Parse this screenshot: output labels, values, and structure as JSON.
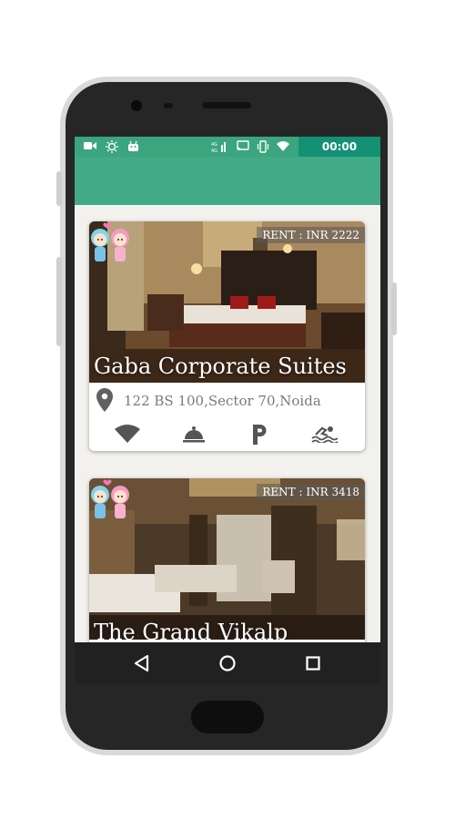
{
  "statusbar": {
    "clock": "00:00",
    "icons": [
      "video-camera-icon",
      "brightness-icon",
      "android-icon",
      "signal-icon",
      "screencast-icon",
      "vibrate-icon",
      "wifi-icon"
    ]
  },
  "listings": [
    {
      "rent": "RENT : INR 2222",
      "name": "Gaba Corporate Suites",
      "address": "122 BS 100,Sector 70,Noida",
      "amenities": [
        "wifi-icon",
        "room-service-icon",
        "parking-icon",
        "pool-icon"
      ]
    },
    {
      "rent": "RENT : INR 3418",
      "name": "The Grand Vikalp"
    }
  ],
  "navbar": {
    "buttons": [
      "back-icon",
      "home-icon",
      "recents-icon"
    ]
  },
  "colors": {
    "statusbar": "#3aa57f",
    "appbar": "#42aa86",
    "clock_bg": "#149174",
    "background": "#f3f1ee"
  }
}
